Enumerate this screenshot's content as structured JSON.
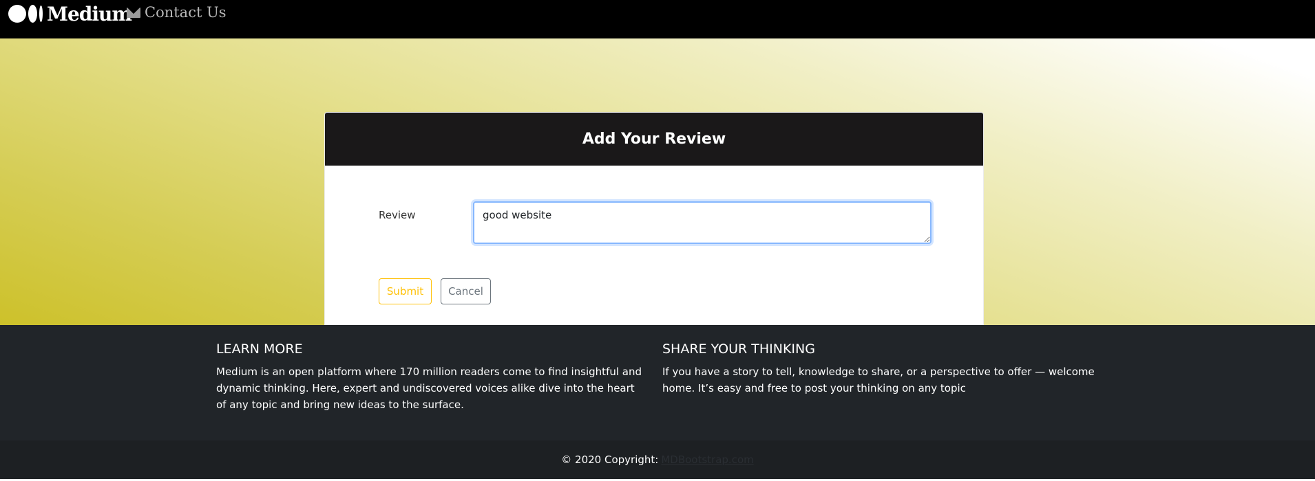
{
  "navbar": {
    "brand": "Medium",
    "contact_label": "Contact Us",
    "contact_icon": "envelope-icon"
  },
  "card": {
    "title": "Add Your Review",
    "review_label": "Review",
    "review_value": "good website",
    "submit_label": "Submit",
    "cancel_label": "Cancel"
  },
  "footer": {
    "learn_heading": "LEARN MORE",
    "learn_text": "Medium is an open platform where 170 million readers come to find insightful and dynamic thinking. Here, expert and undiscovered voices alike dive into the heart of any topic and bring new ideas to the surface.",
    "share_heading": "SHARE YOUR THINKING",
    "share_text": "If you have a story to tell, knowledge to share, or a perspective to offer — welcome home. It’s easy and free to post your thinking on any topic",
    "copyright_text": "© 2020 Copyright:",
    "copyright_link": "MDBootstrap.com"
  },
  "colors": {
    "navbar_bg": "#000000",
    "card_header_bg": "#1a1819",
    "submit_accent": "#ffc107",
    "cancel_accent": "#6c757d",
    "footer_bg": "#212529"
  }
}
